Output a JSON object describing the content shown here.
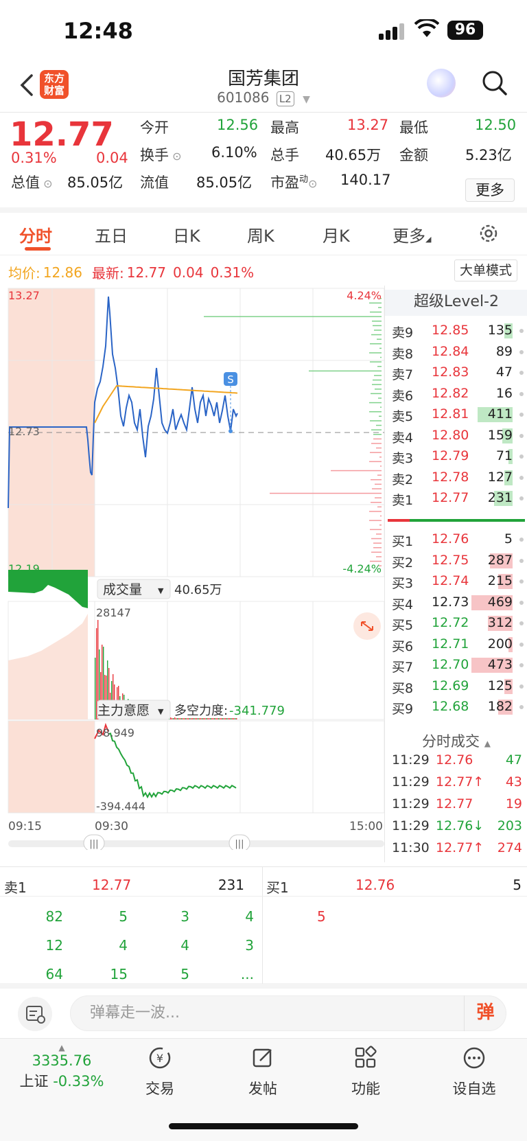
{
  "status": {
    "time": "12:48",
    "battery": "96"
  },
  "header": {
    "logo_text_1": "东方",
    "logo_text_2": "财富",
    "stock_name": "国芳集团",
    "stock_code": "601086",
    "level_badge": "L2"
  },
  "quote": {
    "price": "12.77",
    "change_pct": "0.31%",
    "change": "0.04",
    "open_label": "今开",
    "open": "12.56",
    "high_label": "最高",
    "high": "13.27",
    "low_label": "最低",
    "low": "12.50",
    "turnover_label": "换手",
    "turnover": "6.10%",
    "volume_label": "总手",
    "volume": "40.65万",
    "amount_label": "金额",
    "amount": "5.23亿",
    "mktcap_label": "总值",
    "mktcap": "85.05亿",
    "float_label": "流值",
    "float": "85.05亿",
    "pe_label": "市盈",
    "pe_sup": "动",
    "pe": "140.17",
    "more_label": "更多"
  },
  "tabs": [
    {
      "label": "分时",
      "active": true
    },
    {
      "label": "五日"
    },
    {
      "label": "日K"
    },
    {
      "label": "周K"
    },
    {
      "label": "月K"
    },
    {
      "label": "更多"
    }
  ],
  "info_line": {
    "avg_label": "均价:",
    "avg": "12.86",
    "latest_label": "最新:",
    "latest": "12.77",
    "latest_change": "0.04",
    "latest_pct": "0.31%",
    "big_order_label": "大单模式"
  },
  "chart_data": {
    "type": "line",
    "price_axis": {
      "top": "13.27",
      "mid": "12.73",
      "bottom": "12.19",
      "top_pct": "4.24%",
      "bottom_pct": "-4.24%"
    },
    "time_axis": [
      "09:15",
      "09:30",
      "15:00"
    ],
    "marker": "S",
    "volume_label": "成交量",
    "volume_total": "40.65万",
    "volume_max": "28147",
    "intent_label": "主力意愿",
    "force_label": "多空力度:",
    "force_value": "-341.779",
    "intent_top": "98.949",
    "intent_bottom": "-394.444"
  },
  "orderbook": {
    "title": "超级Level-2",
    "asks": [
      {
        "label": "卖9",
        "price": "12.85",
        "vol": "135",
        "fill": 0.2
      },
      {
        "label": "卖8",
        "price": "12.84",
        "vol": "89",
        "fill": 0
      },
      {
        "label": "卖7",
        "price": "12.83",
        "vol": "47",
        "fill": 0
      },
      {
        "label": "卖6",
        "price": "12.82",
        "vol": "16",
        "fill": 0
      },
      {
        "label": "卖5",
        "price": "12.81",
        "vol": "411",
        "fill": 0.85
      },
      {
        "label": "卖4",
        "price": "12.80",
        "vol": "159",
        "fill": 0.25
      },
      {
        "label": "卖3",
        "price": "12.79",
        "vol": "71",
        "fill": 0.1
      },
      {
        "label": "卖2",
        "price": "12.78",
        "vol": "127",
        "fill": 0.2
      },
      {
        "label": "卖1",
        "price": "12.77",
        "vol": "231",
        "fill": 0.45
      }
    ],
    "bids": [
      {
        "label": "买1",
        "price": "12.76",
        "vol": "5",
        "fill": 0
      },
      {
        "label": "买2",
        "price": "12.75",
        "vol": "287",
        "fill": 0.55
      },
      {
        "label": "买3",
        "price": "12.74",
        "vol": "215",
        "fill": 0.35
      },
      {
        "label": "买4",
        "price": "12.73",
        "vol": "469",
        "fill": 1.0
      },
      {
        "label": "买5",
        "price": "12.72",
        "vol": "312",
        "fill": 0.6
      },
      {
        "label": "买6",
        "price": "12.71",
        "vol": "200",
        "fill": 0.1
      },
      {
        "label": "买7",
        "price": "12.70",
        "vol": "473",
        "fill": 1.0
      },
      {
        "label": "买8",
        "price": "12.69",
        "vol": "125",
        "fill": 0.2
      },
      {
        "label": "买9",
        "price": "12.68",
        "vol": "182",
        "fill": 0.35
      }
    ]
  },
  "trades": {
    "title": "分时成交",
    "rows": [
      {
        "time": "11:29",
        "price": "12.76",
        "vol": "47",
        "side": "buy"
      },
      {
        "time": "11:29",
        "price": "12.77↑",
        "vol": "43",
        "side": "sell"
      },
      {
        "time": "11:29",
        "price": "12.77",
        "vol": "19",
        "side": "sell"
      },
      {
        "time": "11:29",
        "price": "12.76↓",
        "vol": "203",
        "side": "buy"
      },
      {
        "time": "11:30",
        "price": "12.77↑",
        "vol": "274",
        "side": "sell"
      }
    ]
  },
  "queue": {
    "sell_label": "卖1",
    "sell_price": "12.77",
    "sell_total": "231",
    "buy_label": "买1",
    "buy_price": "12.76",
    "buy_total": "5",
    "sell_orders": [
      "82",
      "5",
      "3",
      "4",
      "12",
      "4",
      "4",
      "3",
      "64",
      "15",
      "5",
      "..."
    ],
    "buy_orders": [
      "5"
    ]
  },
  "comment": {
    "placeholder": "弹幕走一波...",
    "toggle": "弹"
  },
  "nav": {
    "index_value": "3335.76",
    "index_name": "上证",
    "index_change": "-0.33%",
    "trade": "交易",
    "post": "发帖",
    "function": "功能",
    "watch": "设自选"
  }
}
